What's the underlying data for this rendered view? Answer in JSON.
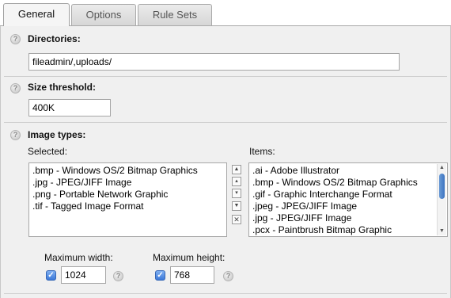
{
  "tabs": [
    {
      "label": "General",
      "active": true
    },
    {
      "label": "Options",
      "active": false
    },
    {
      "label": "Rule Sets",
      "active": false
    }
  ],
  "directories": {
    "label": "Directories:",
    "value": "fileadmin/,uploads/"
  },
  "size_threshold": {
    "label": "Size threshold:",
    "value": "400K"
  },
  "image_types": {
    "label": "Image types:",
    "selected_label": "Selected:",
    "items_label": "Items:",
    "selected": [
      ".bmp - Windows OS/2 Bitmap Graphics",
      ".jpg - JPEG/JIFF Image",
      ".png - Portable Network Graphic",
      ".tif - Tagged Image Format"
    ],
    "items": [
      ".ai - Adobe Illustrator",
      ".bmp - Windows OS/2 Bitmap Graphics",
      ".gif - Graphic Interchange Format",
      ".jpeg - JPEG/JIFF Image",
      ".jpg - JPEG/JIFF Image",
      ".pcx - Paintbrush Bitmap Graphic"
    ],
    "move_buttons": [
      "move-to-top-icon",
      "move-up-icon",
      "move-down-icon",
      "move-to-bottom-icon",
      "remove-icon"
    ]
  },
  "max_width": {
    "label": "Maximum width:",
    "checked": true,
    "value": "1024"
  },
  "max_height": {
    "label": "Maximum height:",
    "checked": true,
    "value": "768"
  },
  "colors": {
    "panel_bg": "#f0f0f0",
    "checkbox_blue": "#3c78d8",
    "scroll_thumb": "#3c74c0"
  }
}
